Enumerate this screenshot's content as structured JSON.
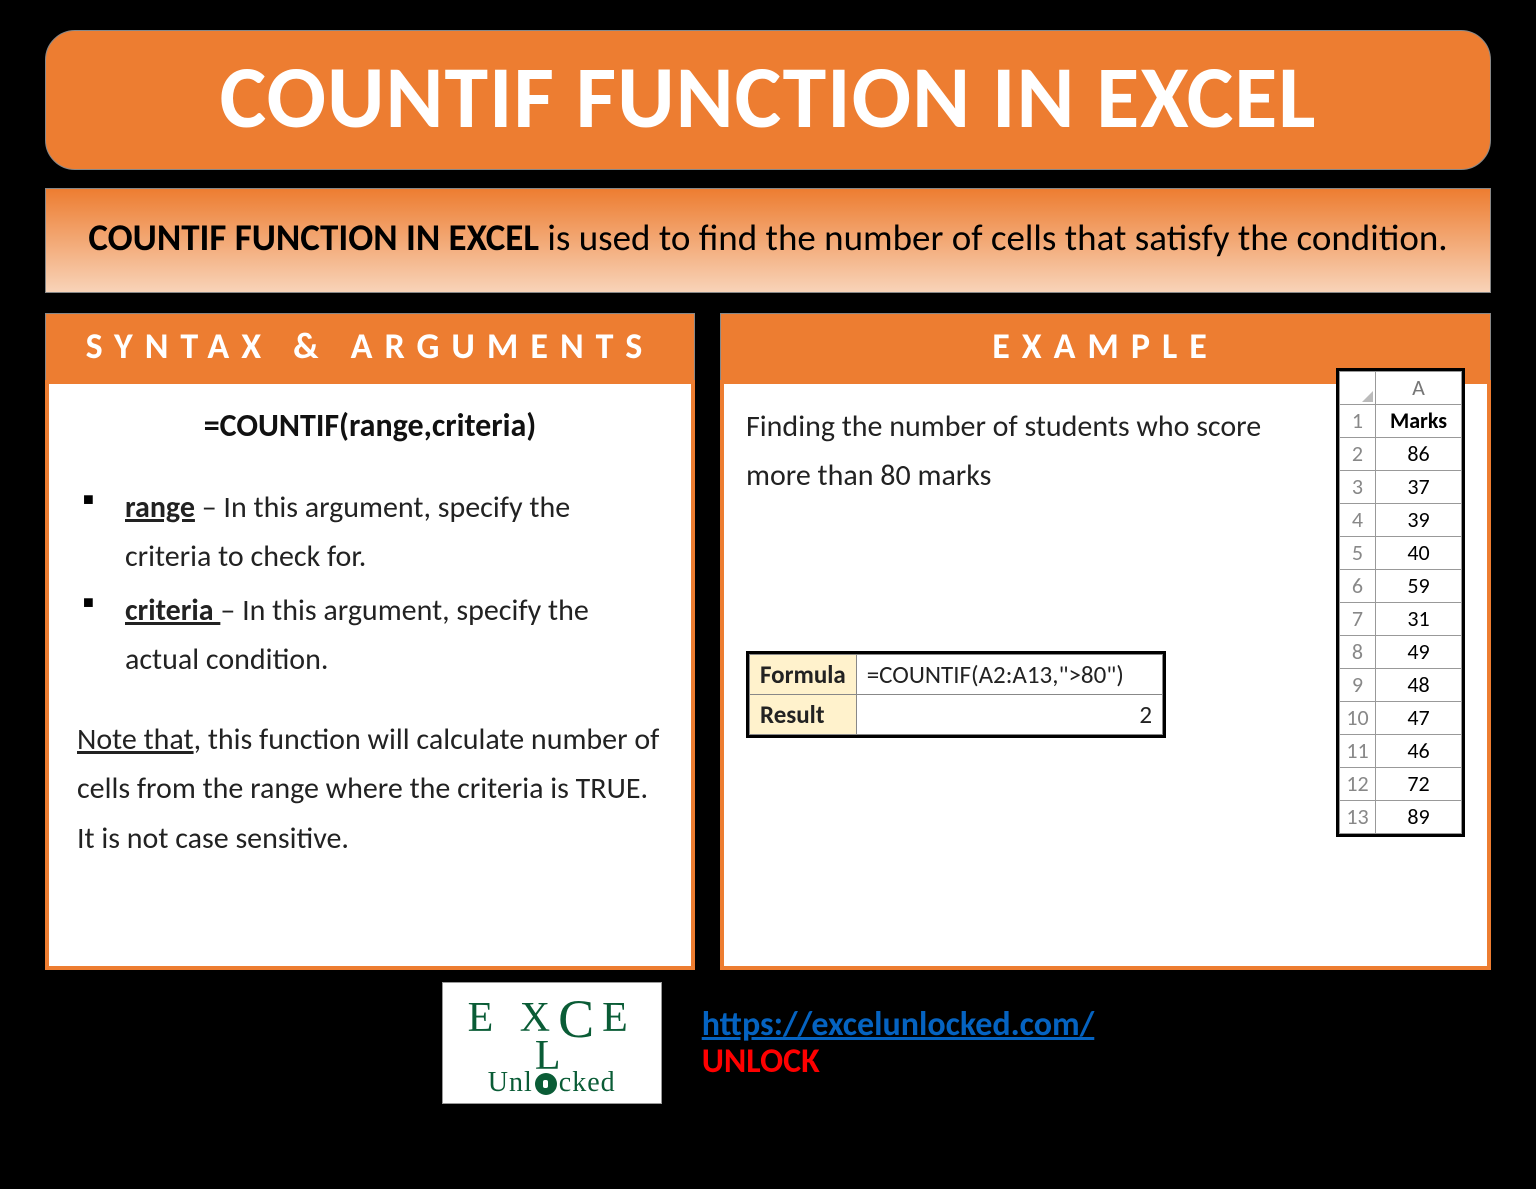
{
  "title": "COUNTIF FUNCTION IN EXCEL",
  "description": {
    "bold": "COUNTIF FUNCTION IN EXCEL",
    "rest": " is used to find the number of cells that satisfy the condition."
  },
  "syntax_header": "SYNTAX & ARGUMENTS",
  "example_header": "EXAMPLE",
  "syntax": "=COUNTIF(range,criteria)",
  "args": [
    {
      "name": "range",
      "desc": " – In this argument, specify the criteria to check for."
    },
    {
      "name": "criteria ",
      "desc": "– In this argument, specify the actual condition."
    }
  ],
  "note": {
    "lead": "Note that",
    "rest": ", this function will calculate number of cells from the range where the criteria is TRUE. It is not case sensitive."
  },
  "example": {
    "desc": "Finding the number of students who score more than 80 marks",
    "formula_label": "Formula",
    "formula_value": "=COUNTIF(A2:A13,\">80\")",
    "result_label": "Result",
    "result_value": "2",
    "col_letter": "A",
    "data_header": "Marks",
    "rows": [
      {
        "n": "1",
        "v": "Marks"
      },
      {
        "n": "2",
        "v": "86"
      },
      {
        "n": "3",
        "v": "37"
      },
      {
        "n": "4",
        "v": "39"
      },
      {
        "n": "5",
        "v": "40"
      },
      {
        "n": "6",
        "v": "59"
      },
      {
        "n": "7",
        "v": "31"
      },
      {
        "n": "8",
        "v": "49"
      },
      {
        "n": "9",
        "v": "48"
      },
      {
        "n": "10",
        "v": "47"
      },
      {
        "n": "11",
        "v": "46"
      },
      {
        "n": "12",
        "v": "72"
      },
      {
        "n": "13",
        "v": "89"
      }
    ]
  },
  "footer": {
    "url": "https://excelunlocked.com/",
    "unlock": "UNLOCK",
    "logo1a": "E X",
    "logo1b": "E L",
    "logo2a": "Unl",
    "logo2b": "cked"
  }
}
